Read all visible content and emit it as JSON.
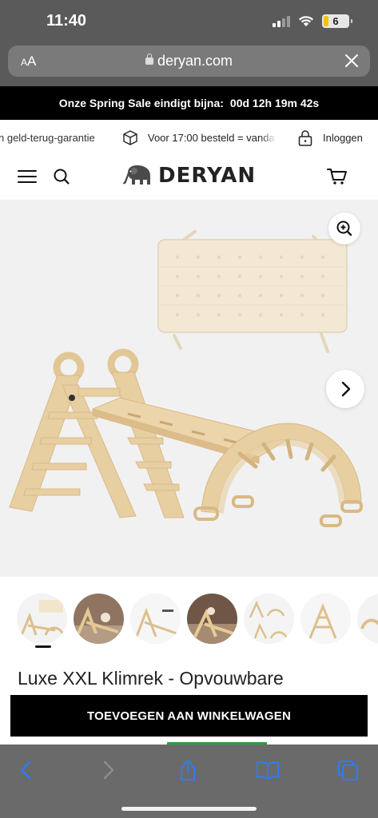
{
  "status_bar": {
    "time": "11:40",
    "battery": "6",
    "icons": [
      "cellular-signal-icon",
      "wifi-icon",
      "battery-icon"
    ]
  },
  "browser": {
    "text_size_label": "AA",
    "url": "deryan.com",
    "icons": [
      "lock-icon",
      "close-icon"
    ]
  },
  "sale_banner": {
    "text": "Onze Spring Sale eindigt bijna:",
    "countdown": "00d 12h 19m 42s"
  },
  "usp_bar": {
    "items": [
      {
        "label": "n geld-terug-garantie",
        "icon": null
      },
      {
        "label": "Voor 17:00 besteld = vanda",
        "icon": "package-icon"
      },
      {
        "label": "Inloggen",
        "icon": "lock-icon"
      }
    ]
  },
  "header": {
    "logo_text": "DERYAN",
    "icons": [
      "hamburger-menu-icon",
      "search-icon",
      "elephant-logo-icon",
      "cart-icon"
    ]
  },
  "product": {
    "title": "Luxe XXL Klimrek - Opvouwbare",
    "add_to_cart_label": "TOEVOEGEN AAN WINKELWAGEN",
    "image_icons": [
      "zoom-in-icon",
      "chevron-right-icon"
    ],
    "thumbnail_count": 7
  },
  "toolbar": {
    "icons": [
      "back-icon",
      "forward-icon",
      "share-icon",
      "bookmarks-icon",
      "tabs-icon"
    ]
  },
  "colors": {
    "banner": "#000000",
    "accent_blue": "#2f7bf6",
    "wood": "#e7cfa2",
    "cushion": "#f2e8d3"
  }
}
